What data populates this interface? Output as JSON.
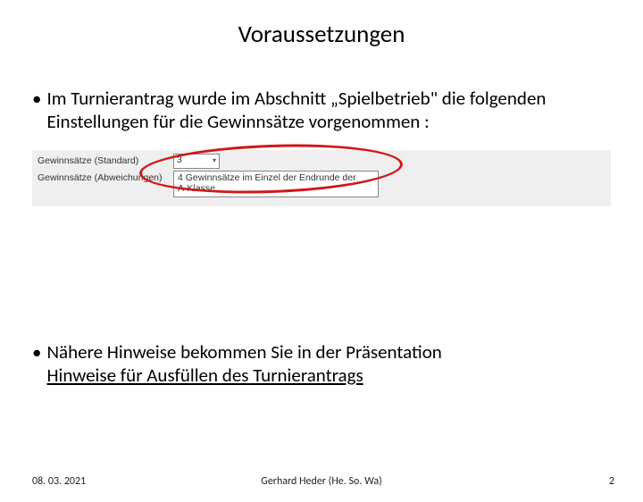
{
  "title": "Voraussetzungen",
  "bullet1": "Im Turnierantrag wurde im Abschnitt „Spielbetrieb\" die folgenden Einstellungen für die Gewinnsätze vorgenommen :",
  "form": {
    "row1_label": "Gewinnsätze (Standard)",
    "row1_value": "3",
    "row2_label": "Gewinnsätze (Abweichungen)",
    "row2_value_line1": "4 Gewinnsätze im Einzel der Endrunde der",
    "row2_value_line2": "A-Klasse."
  },
  "bullet2_pre": "Nähere Hinweise bekommen Sie in der Präsentation ",
  "bullet2_link": "Hinweise für Ausfüllen des Turnierantrags",
  "footer": {
    "date": "08. 03. 2021",
    "author": "Gerhard Heder (He. So. Wa)",
    "page": "2"
  }
}
